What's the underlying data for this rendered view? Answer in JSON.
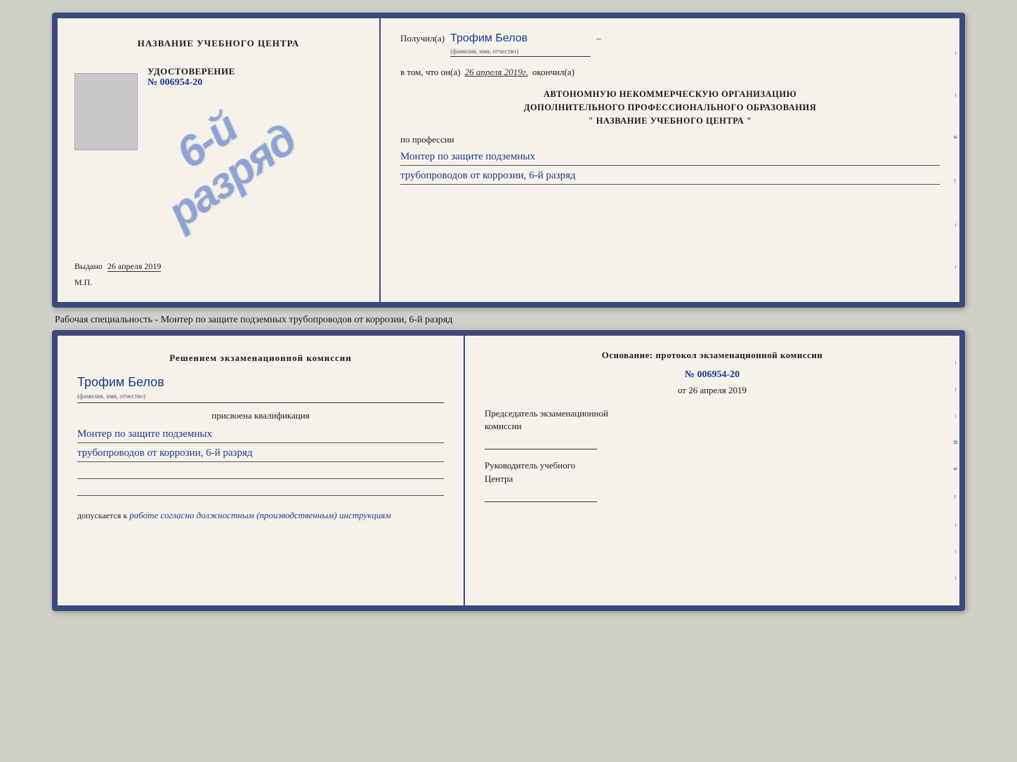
{
  "page": {
    "background": "#d0cfc8"
  },
  "certificate": {
    "left": {
      "title": "НАЗВАНИЕ УЧЕБНОГО ЦЕНТРА",
      "stamp_line1": "6-й",
      "stamp_line2": "разряд",
      "udost_title": "УДОСТОВЕРЕНИЕ",
      "udost_number": "№ 006954-20",
      "vydano_label": "Выдано",
      "vydano_date": "26 апреля 2019",
      "mp_label": "М.П."
    },
    "right": {
      "poluchil_label": "Получил(а)",
      "fio_handwritten": "Трофим Белов",
      "fio_sublabel": "(фамилия, имя, отчество)",
      "dash": "–",
      "vtom_label": "в том, что он(а)",
      "date_handwritten": "26 апреля 2019г.",
      "okonchil_label": "окончил(а)",
      "org_line1": "АВТОНОМНУЮ НЕКОММЕРЧЕСКУЮ ОРГАНИЗАЦИЮ",
      "org_line2": "ДОПОЛНИТЕЛЬНОГО ПРОФЕССИОНАЛЬНОГО ОБРАЗОВАНИЯ",
      "org_quote_open": "\"",
      "org_name": "НАЗВАНИЕ УЧЕБНОГО ЦЕНТРА",
      "org_quote_close": "\"",
      "po_professii": "по профессии",
      "profession_line1": "Монтер по защите подземных",
      "profession_line2": "трубопроводов от коррозии, 6-й разряд",
      "side_chars": [
        "–",
        "–",
        "а",
        "←",
        "–",
        "–",
        "–",
        "–",
        "–"
      ]
    }
  },
  "info_text": "Рабочая специальность - Монтер по защите подземных трубопроводов от коррозии, 6-й разряд",
  "qualification": {
    "left": {
      "resheniem_title": "Решением экзаменационной комиссии",
      "fio_handwritten": "Трофим Белов",
      "fio_sublabel": "(фамилия, имя, отчество)",
      "prisvoena": "присвоена квалификация",
      "profession_line1": "Монтер по защите подземных",
      "profession_line2": "трубопроводов от коррозии, 6-й разряд",
      "dopuskaetsya": "допускается к",
      "dop_handwritten": "работе согласно должностным (производственным) инструкциям"
    },
    "right": {
      "osnov_title": "Основание: протокол экзаменационной комиссии",
      "proto_number": "№ 006954-20",
      "proto_ot": "от",
      "proto_date": "26 апреля 2019",
      "predsedatel_line1": "Председатель экзаменационной",
      "predsedatel_line2": "комиссии",
      "rukovoditel_line1": "Руководитель учебного",
      "rukovoditel_line2": "Центра",
      "side_chars": [
        "–",
        "–",
        "–",
        "и",
        "а",
        "←",
        "–",
        "–",
        "–",
        "–",
        "–"
      ]
    }
  }
}
